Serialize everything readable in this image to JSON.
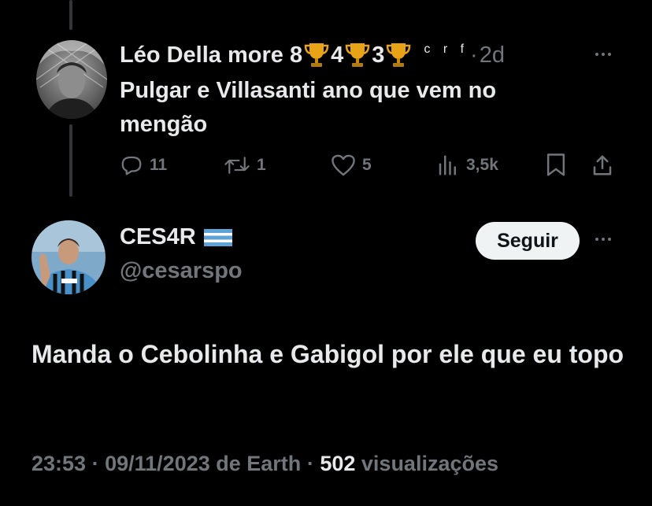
{
  "reply": {
    "name_text": "Léo Della more 8",
    "count_a": "4",
    "count_b": "3",
    "suffix": "c r f",
    "separator": "·",
    "time": "2d",
    "text": "Pulgar e Villasanti ano que vem no mengão",
    "stats": {
      "replies": "11",
      "reposts": "1",
      "likes": "5",
      "views": "3,5k"
    }
  },
  "tweet": {
    "name": "CES4R",
    "handle": "@cesarspo",
    "follow_label": "Seguir",
    "text": "Manda o Cebolinha e Gabigol por ele que eu topo",
    "time": "23:53",
    "date": "09/11/2023",
    "source": "de Earth",
    "views_count": "502",
    "views_label": "visualizações",
    "separator": "·"
  },
  "colors": {
    "background": "#000000",
    "text": "#e7e9ea",
    "muted": "#71767b",
    "thread_line": "#333639",
    "trophy": "#e8a317",
    "follow_bg": "#eff3f4"
  },
  "icons": [
    "trophy-icon",
    "more-icon",
    "reply-icon",
    "repost-icon",
    "like-icon",
    "views-icon",
    "bookmark-icon",
    "share-icon",
    "flag-icon"
  ]
}
